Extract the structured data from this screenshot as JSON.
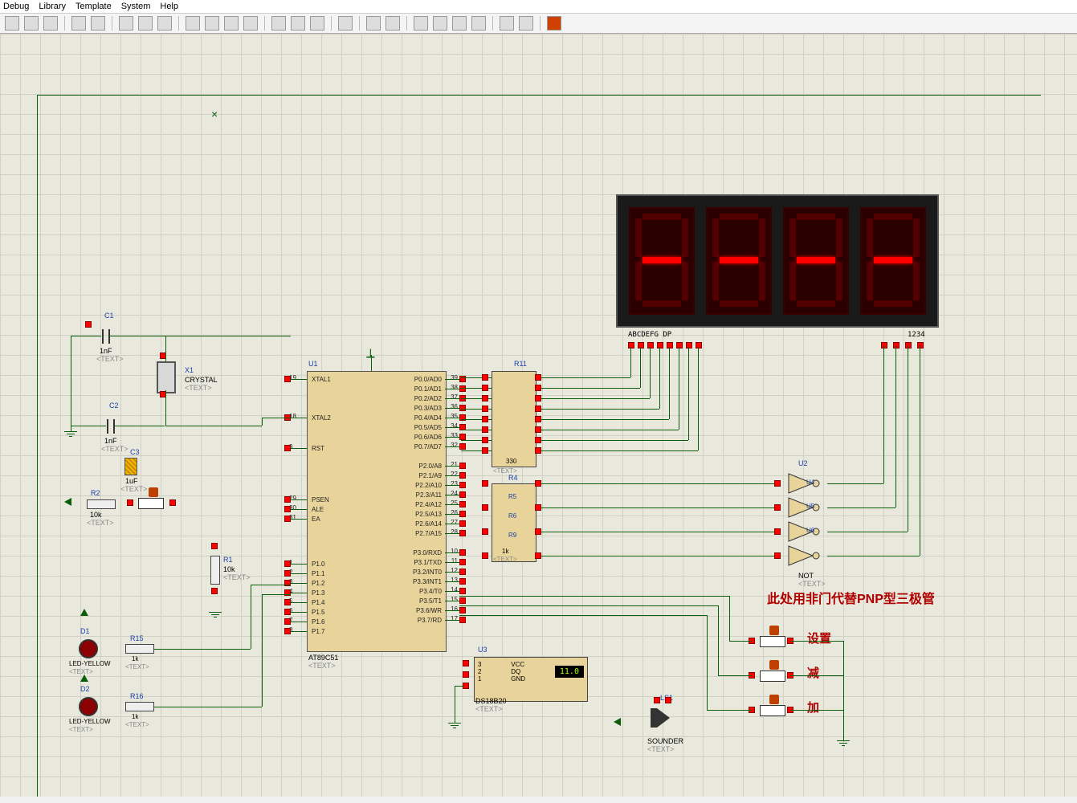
{
  "menu": {
    "debug": "Debug",
    "library": "Library",
    "template": "Template",
    "system": "System",
    "help": "Help"
  },
  "components": {
    "C1": {
      "ref": "C1",
      "val": "1nF",
      "sub": "<TEXT>"
    },
    "C2": {
      "ref": "C2",
      "val": "1nF",
      "sub": "<TEXT>"
    },
    "C3": {
      "ref": "C3",
      "val": "1uF",
      "sub": "<TEXT>"
    },
    "X1": {
      "ref": "X1",
      "val": "CRYSTAL",
      "sub": "<TEXT>"
    },
    "R1": {
      "ref": "R1",
      "val": "10k",
      "sub": "<TEXT>"
    },
    "R2": {
      "ref": "R2",
      "val": "10k",
      "sub": "<TEXT>"
    },
    "R4": {
      "ref": "R4",
      "sub": "<TEXT>"
    },
    "R5": {
      "ref": "R5",
      "sub": "<TEXT>"
    },
    "R6": {
      "ref": "R6",
      "sub": "<TEXT>"
    },
    "R9": {
      "ref": "R9",
      "val": "1k",
      "sub": "<TEXT>"
    },
    "R11": {
      "ref": "R11",
      "val": "330",
      "sub": "<TEXT>"
    },
    "R15": {
      "ref": "R15",
      "val": "1k",
      "sub": "<TEXT>"
    },
    "R16": {
      "ref": "R16",
      "val": "1k",
      "sub": "<TEXT>"
    },
    "U1": {
      "ref": "U1",
      "val": "AT89C51",
      "sub": "<TEXT>"
    },
    "U2": {
      "ref": "U2",
      "val": "NOT",
      "sub": "<TEXT>",
      "gates": [
        "U4",
        "U5",
        "U6"
      ]
    },
    "U3": {
      "ref": "U3",
      "val": "DS18B20",
      "sub": "<TEXT>",
      "disp": "11.0",
      "pins": [
        "VCC",
        "DQ",
        "GND"
      ],
      "nums": [
        "3",
        "2",
        "1"
      ]
    },
    "D1": {
      "ref": "D1",
      "val": "LED-YELLOW",
      "sub": "<TEXT>"
    },
    "D2": {
      "ref": "D2",
      "val": "LED-YELLOW",
      "sub": "<TEXT>"
    },
    "LS1": {
      "ref": "LS1",
      "val": "SOUNDER",
      "sub": "<TEXT>"
    }
  },
  "u1pins_left": [
    {
      "n": "19",
      "t": "XTAL1"
    },
    {
      "n": "18",
      "t": "XTAL2"
    },
    {
      "n": "9",
      "t": "RST"
    },
    {
      "n": "29",
      "t": "PSEN"
    },
    {
      "n": "30",
      "t": "ALE"
    },
    {
      "n": "31",
      "t": "EA"
    },
    {
      "n": "1",
      "t": "P1.0"
    },
    {
      "n": "2",
      "t": "P1.1"
    },
    {
      "n": "3",
      "t": "P1.2"
    },
    {
      "n": "4",
      "t": "P1.3"
    },
    {
      "n": "5",
      "t": "P1.4"
    },
    {
      "n": "6",
      "t": "P1.5"
    },
    {
      "n": "7",
      "t": "P1.6"
    },
    {
      "n": "8",
      "t": "P1.7"
    }
  ],
  "u1pins_right": [
    {
      "n": "39",
      "t": "P0.0/AD0"
    },
    {
      "n": "38",
      "t": "P0.1/AD1"
    },
    {
      "n": "37",
      "t": "P0.2/AD2"
    },
    {
      "n": "36",
      "t": "P0.3/AD3"
    },
    {
      "n": "35",
      "t": "P0.4/AD4"
    },
    {
      "n": "34",
      "t": "P0.5/AD5"
    },
    {
      "n": "33",
      "t": "P0.6/AD6"
    },
    {
      "n": "32",
      "t": "P0.7/AD7"
    },
    {
      "n": "21",
      "t": "P2.0/A8"
    },
    {
      "n": "22",
      "t": "P2.1/A9"
    },
    {
      "n": "23",
      "t": "P2.2/A10"
    },
    {
      "n": "24",
      "t": "P2.3/A11"
    },
    {
      "n": "25",
      "t": "P2.4/A12"
    },
    {
      "n": "26",
      "t": "P2.5/A13"
    },
    {
      "n": "27",
      "t": "P2.6/A14"
    },
    {
      "n": "28",
      "t": "P2.7/A15"
    },
    {
      "n": "10",
      "t": "P3.0/RXD"
    },
    {
      "n": "11",
      "t": "P3.1/TXD"
    },
    {
      "n": "12",
      "t": "P3.2/INT0"
    },
    {
      "n": "13",
      "t": "P3.3/INT1"
    },
    {
      "n": "14",
      "t": "P3.4/T0"
    },
    {
      "n": "15",
      "t": "P3.5/T1"
    },
    {
      "n": "16",
      "t": "P3.6/WR"
    },
    {
      "n": "17",
      "t": "P3.7/RD"
    }
  ],
  "display": {
    "label_left": "ABCDEFG DP",
    "label_right": "1234"
  },
  "annotations": {
    "note": "此处用非门代替PNP型三极管",
    "btn_set": "设置",
    "btn_dec": "减",
    "btn_inc": "加"
  }
}
